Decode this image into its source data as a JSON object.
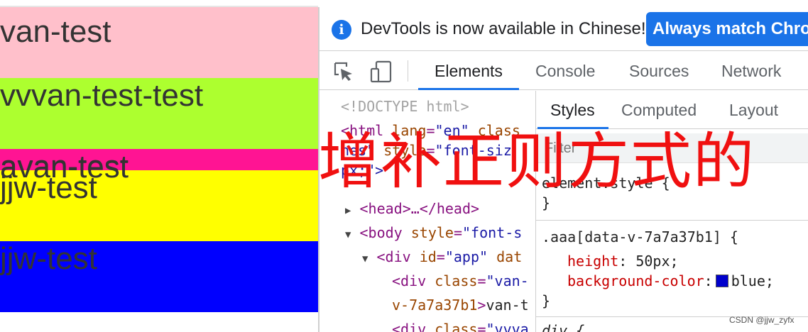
{
  "preview": {
    "blocks": [
      {
        "text": "van-test",
        "bg": "#ffc0cb"
      },
      {
        "text": "vvvan-test-test",
        "bg": "#adff2f"
      },
      {
        "text": "avan-test",
        "bg": "#ff1493"
      },
      {
        "text": "jjw-test",
        "bg": "#ffff00"
      },
      {
        "text": "jjw-test",
        "bg": "#0000ff"
      }
    ]
  },
  "devtools": {
    "infobar": {
      "message": "DevTools is now available in Chinese!",
      "button_label": "Always match Chrome's language"
    },
    "tabs": [
      "Elements",
      "Console",
      "Sources",
      "Network"
    ],
    "active_tab": "Elements",
    "elements": {
      "doctype": "<!DOCTYPE html>",
      "html_line1": {
        "tag_open": "<html",
        "attr1": "lang",
        "val1": "\"en\"",
        "attr2": "class"
      },
      "html_line2": {
        "val_tail": "nes\"",
        "attr": "style",
        "val": "\"font-siz"
      },
      "html_line3": {
        "text": "px;\">"
      },
      "head_line": "<head>…</head>",
      "body_line": {
        "tag_open": "<body",
        "attr": "style",
        "val": "\"font-s"
      },
      "app_line": {
        "tag_open": "<div",
        "attr1": "id",
        "val1": "\"app\"",
        "attr2": "dat"
      },
      "van_line1": {
        "tag_open": "<div",
        "attr": "class",
        "val": "\"van-"
      },
      "van_line2": {
        "attr": "v-7a7a37b1",
        "text": "van-t"
      },
      "vvva_line": {
        "tag_open": "<div",
        "attr": "class",
        "val": "\"vvva"
      }
    },
    "styles": {
      "subtabs": [
        "Styles",
        "Computed",
        "Layout"
      ],
      "active_subtab": "Styles",
      "filter_placeholder": "Filter",
      "element_style_selector": "element.style {",
      "rule_close": "}",
      "aaa_selector": ".aaa[data-v-7a7a37b1] {",
      "props": [
        {
          "name": "height",
          "value": "50px;"
        },
        {
          "name": "background-color",
          "value": "blue;",
          "swatch": "#0000cc"
        }
      ],
      "div_selector": "div {"
    }
  },
  "overlay": {
    "text": "增补正则方式的",
    "color": "#f01010"
  },
  "watermark": "CSDN @jjw_zyfx"
}
